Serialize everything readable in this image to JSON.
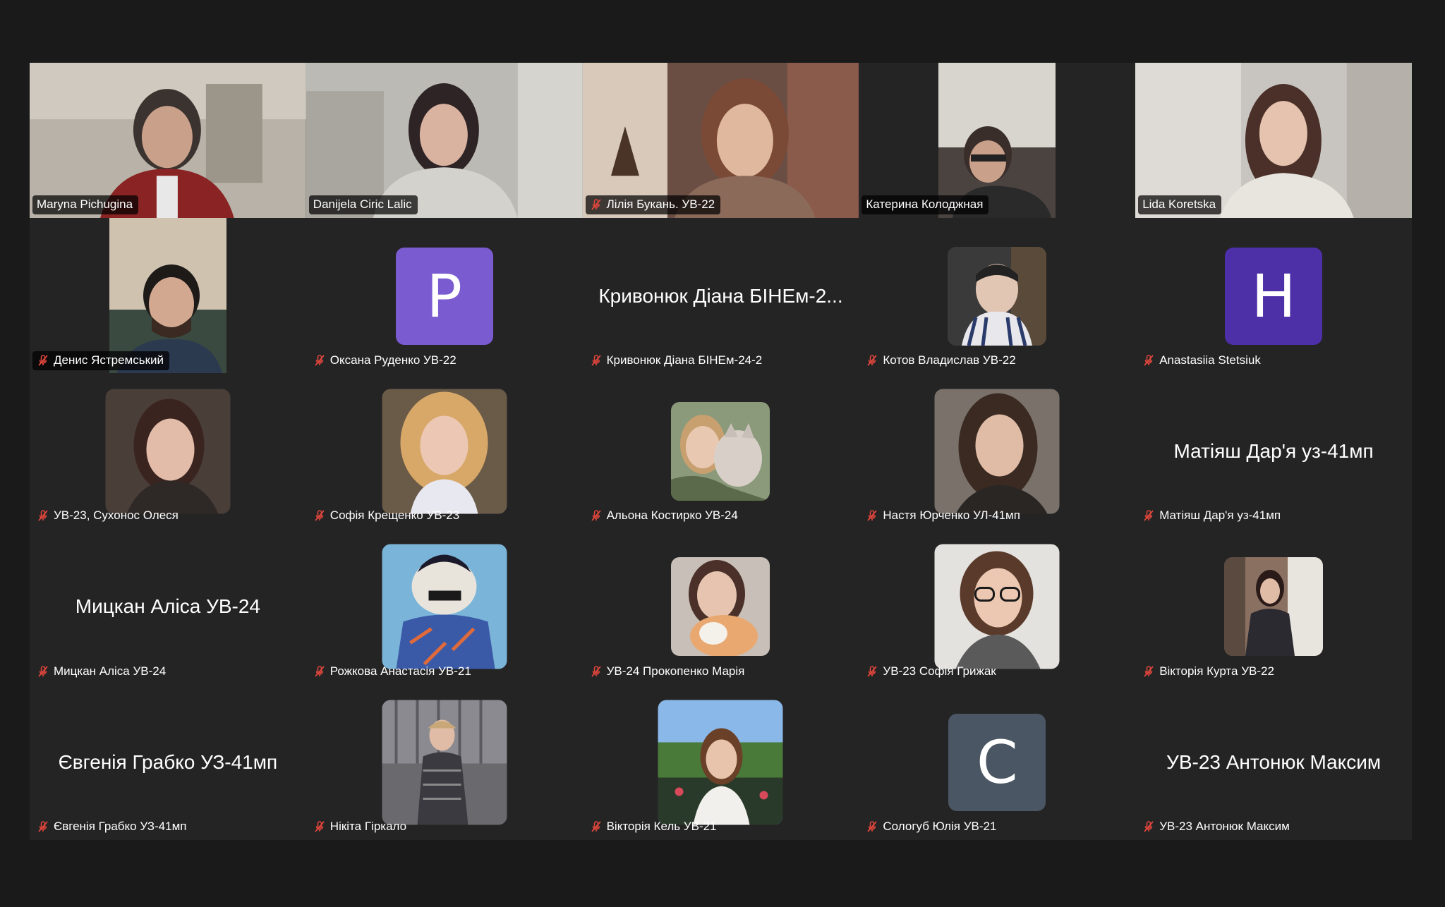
{
  "participants": [
    {
      "name": "Maryna Pichugina",
      "muted": false
    },
    {
      "name": "Danijela Ciric Lalic",
      "muted": false
    },
    {
      "name": "Лілія Букань. УВ-22",
      "muted": true
    },
    {
      "name": "Катерина Колоджная",
      "muted": false
    },
    {
      "name": "Lida Koretska",
      "muted": false,
      "active": true
    },
    {
      "name": "Денис Ястремський",
      "muted": true
    },
    {
      "name": "Оксана Руденко УВ-22",
      "muted": true,
      "initial": "P",
      "avatar_color": "#7b5bd0"
    },
    {
      "name": "Кривонюк Діана БІНЕм-24-2",
      "muted": true,
      "display": "Кривонюк Діана БІНЕм-2..."
    },
    {
      "name": "Котов Владислав УВ-22",
      "muted": true
    },
    {
      "name": "Anastasiia Stetsiuk",
      "muted": true,
      "initial": "H",
      "avatar_color": "#4d2fa8"
    },
    {
      "name": "УВ-23, Сухонос Олеся",
      "muted": true
    },
    {
      "name": "Софія Крещенко УВ-23",
      "muted": true
    },
    {
      "name": "Альона Костирко УВ-24",
      "muted": true
    },
    {
      "name": "Настя Юрченко УЛ-41мп",
      "muted": true
    },
    {
      "name": "Матіяш Дар'я уз-41мп",
      "muted": true,
      "display": "Матіяш Дар'я уз-41мп"
    },
    {
      "name": "Мицкан Аліса УВ-24",
      "muted": true,
      "display": "Мицкан Аліса УВ-24"
    },
    {
      "name": "Рожкова Анастасія УВ-21",
      "muted": true
    },
    {
      "name": "УВ-24 Прокопенко Марія",
      "muted": true
    },
    {
      "name": "УВ-23 Софія Грижак",
      "muted": true
    },
    {
      "name": "Вікторія Курта УВ-22",
      "muted": true
    },
    {
      "name": "Євгенія Грабко УЗ-41мп",
      "muted": true,
      "display": "Євгенія Грабко УЗ-41мп"
    },
    {
      "name": "Нікіта Гіркало",
      "muted": true
    },
    {
      "name": "Вікторія Кель УВ-21",
      "muted": true
    },
    {
      "name": "Сологуб Юлія УВ-21",
      "muted": true,
      "initial": "C",
      "avatar_color": "#4a5663"
    },
    {
      "name": "УВ-23 Антонюк Максим",
      "muted": true,
      "display": "УВ-23 Антонюк Максим"
    }
  ],
  "colors": {
    "background": "#1a1a1a",
    "tile": "#242424",
    "active_border": "#5fd35f",
    "mute_icon": "#e0463c"
  }
}
